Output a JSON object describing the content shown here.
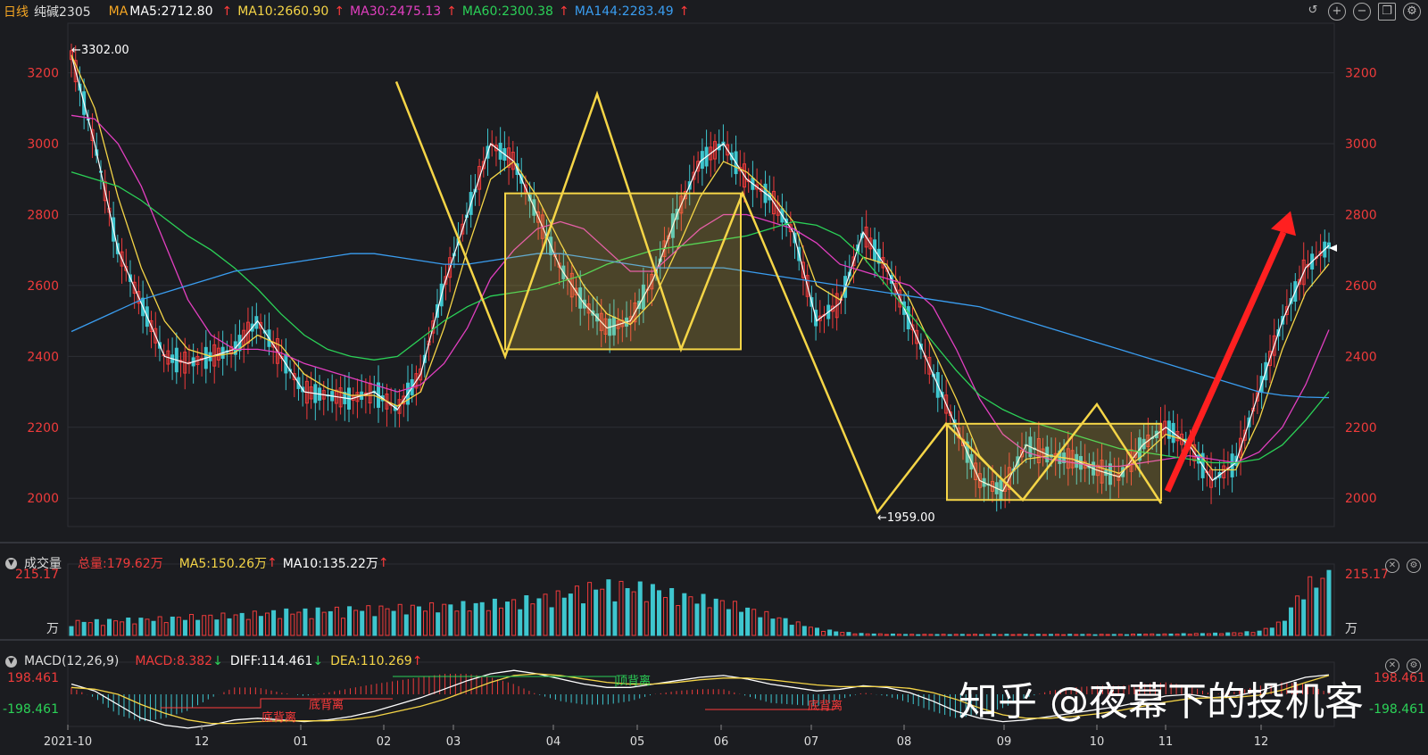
{
  "header": {
    "period": "日线",
    "symbol": "纯碱2305",
    "ma_label": "MA",
    "ma5": "MA5:2712.80",
    "ma10": "MA10:2660.90",
    "ma30": "MA30:2475.13",
    "ma60": "MA60:2300.38",
    "ma144": "MA144:2283.49",
    "up_arrow": "↑"
  },
  "colors": {
    "up": "#ef3b3b",
    "down": "#3ec6cf",
    "ma5": "#ffffff",
    "ma10": "#f5d547",
    "ma30": "#e23fc0",
    "ma60": "#2bd157",
    "ma144": "#3a9df0",
    "accent": "#f5d547"
  },
  "toolbar_icons": [
    "undo-icon",
    "zoom-in-icon",
    "zoom-out-icon",
    "restore-icon",
    "settings-icon"
  ],
  "volume_panel": {
    "title": "成交量",
    "total": "总量:179.62万",
    "ma5": "MA5:150.26万",
    "ma10": "MA10:135.22万",
    "top_tick": "215.17",
    "unit": "万"
  },
  "macd_panel": {
    "title": "MACD(12,26,9)",
    "macd": "MACD:8.382",
    "diff": "DIFF:114.461",
    "dea": "DEA:110.269",
    "top_tick": "198.461",
    "bottom_tick": "-198.461",
    "divergence_labels": [
      "底背离",
      "底背离",
      "顶背离",
      "底背离"
    ]
  },
  "watermark": "知乎 @夜幕下的投机客",
  "chart_data": {
    "type": "line",
    "title": "纯碱2305 日线",
    "ylim": [
      1920,
      3340
    ],
    "y_ticks": [
      "3200",
      "3000",
      "2800",
      "2600",
      "2400",
      "2200",
      "2000"
    ],
    "x_ticks": [
      "2021-10",
      "12",
      "01",
      "02",
      "03",
      "04",
      "05",
      "06",
      "07",
      "08",
      "09",
      "10",
      "11",
      "12"
    ],
    "annotations": {
      "high": "←3302.00",
      "low": "←1959.00"
    },
    "series": [
      {
        "name": "MA5",
        "values": [
          3250,
          3000,
          2700,
          2550,
          2400,
          2380,
          2400,
          2420,
          2500,
          2400,
          2300,
          2290,
          2280,
          2300,
          2250,
          2350,
          2600,
          2800,
          3000,
          2950,
          2800,
          2650,
          2550,
          2480,
          2500,
          2620,
          2800,
          2950,
          3000,
          2900,
          2850,
          2750,
          2500,
          2550,
          2750,
          2650,
          2500,
          2350,
          2200,
          2050,
          2020,
          2150,
          2120,
          2110,
          2080,
          2060,
          2150,
          2200,
          2150,
          2050,
          2100,
          2300,
          2500,
          2650,
          2712.8
        ]
      },
      {
        "name": "MA10",
        "values": [
          3250,
          3100,
          2850,
          2650,
          2500,
          2420,
          2400,
          2410,
          2460,
          2430,
          2350,
          2310,
          2290,
          2290,
          2260,
          2300,
          2480,
          2700,
          2900,
          2950,
          2850,
          2720,
          2600,
          2520,
          2490,
          2560,
          2700,
          2850,
          2950,
          2920,
          2860,
          2780,
          2600,
          2560,
          2680,
          2660,
          2560,
          2420,
          2280,
          2120,
          2050,
          2110,
          2120,
          2110,
          2090,
          2070,
          2120,
          2180,
          2160,
          2080,
          2080,
          2220,
          2420,
          2580,
          2660.9
        ]
      },
      {
        "name": "MA30",
        "values": [
          3080,
          3070,
          3000,
          2880,
          2720,
          2560,
          2460,
          2420,
          2420,
          2410,
          2380,
          2360,
          2340,
          2320,
          2300,
          2320,
          2380,
          2480,
          2620,
          2700,
          2760,
          2780,
          2760,
          2700,
          2640,
          2640,
          2700,
          2760,
          2800,
          2800,
          2780,
          2760,
          2720,
          2660,
          2640,
          2620,
          2600,
          2540,
          2420,
          2280,
          2180,
          2130,
          2110,
          2100,
          2090,
          2090,
          2100,
          2110,
          2120,
          2110,
          2100,
          2130,
          2200,
          2320,
          2475.13
        ]
      },
      {
        "name": "MA60",
        "values": [
          2920,
          2900,
          2880,
          2840,
          2790,
          2740,
          2700,
          2650,
          2590,
          2520,
          2460,
          2420,
          2400,
          2390,
          2400,
          2450,
          2500,
          2540,
          2570,
          2580,
          2590,
          2610,
          2630,
          2660,
          2680,
          2700,
          2710,
          2720,
          2730,
          2740,
          2760,
          2780,
          2770,
          2740,
          2680,
          2600,
          2520,
          2440,
          2360,
          2290,
          2250,
          2220,
          2200,
          2180,
          2160,
          2140,
          2130,
          2120,
          2110,
          2100,
          2100,
          2110,
          2150,
          2220,
          2300.38
        ]
      },
      {
        "name": "MA144",
        "values": [
          2470,
          2500,
          2530,
          2560,
          2580,
          2600,
          2620,
          2640,
          2650,
          2660,
          2670,
          2680,
          2690,
          2690,
          2680,
          2670,
          2660,
          2660,
          2670,
          2680,
          2690,
          2690,
          2680,
          2670,
          2660,
          2650,
          2650,
          2650,
          2650,
          2640,
          2630,
          2620,
          2610,
          2600,
          2590,
          2580,
          2570,
          2560,
          2550,
          2540,
          2520,
          2500,
          2480,
          2460,
          2440,
          2420,
          2400,
          2380,
          2360,
          2340,
          2320,
          2300,
          2290,
          2285,
          2283.49
        ]
      }
    ],
    "volume": [
      40,
      42,
      45,
      48,
      50,
      55,
      58,
      60,
      65,
      70,
      72,
      75,
      78,
      80,
      82,
      85,
      88,
      90,
      95,
      100,
      110,
      120,
      140,
      150,
      145,
      140,
      120,
      110,
      100,
      80,
      60,
      40,
      20,
      10,
      5,
      4,
      3,
      3,
      3,
      3,
      3,
      3,
      3,
      3,
      3,
      3,
      4,
      4,
      5,
      6,
      8,
      12,
      40,
      150,
      179.62
    ],
    "macd_diff": [
      60,
      20,
      -60,
      -140,
      -180,
      -198,
      -180,
      -150,
      -140,
      -150,
      -160,
      -150,
      -130,
      -100,
      -60,
      -20,
      30,
      80,
      120,
      140,
      120,
      90,
      60,
      40,
      40,
      60,
      80,
      100,
      110,
      90,
      60,
      40,
      20,
      30,
      50,
      40,
      10,
      -40,
      -100,
      -140,
      -160,
      -150,
      -130,
      -110,
      -90,
      -70,
      -40,
      -10,
      0,
      -20,
      -10,
      20,
      60,
      100,
      114.461
    ],
    "macd_dea": [
      40,
      30,
      0,
      -60,
      -110,
      -150,
      -170,
      -170,
      -160,
      -155,
      -155,
      -155,
      -148,
      -130,
      -100,
      -70,
      -30,
      20,
      70,
      110,
      120,
      110,
      90,
      70,
      60,
      60,
      70,
      85,
      95,
      95,
      85,
      70,
      55,
      45,
      45,
      45,
      35,
      10,
      -30,
      -80,
      -120,
      -140,
      -140,
      -130,
      -115,
      -95,
      -70,
      -45,
      -25,
      -20,
      -18,
      -5,
      25,
      70,
      110.269
    ]
  }
}
